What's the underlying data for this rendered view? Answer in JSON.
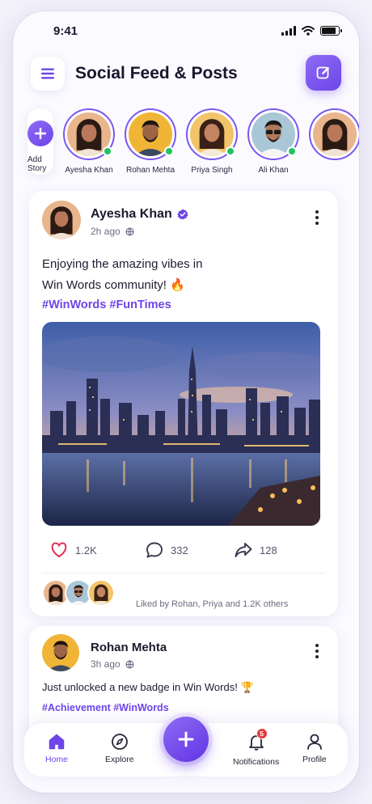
{
  "status_bar": {
    "time": "9:41"
  },
  "header": {
    "title": "Social Feed & Posts"
  },
  "stories": {
    "add_label": "Add Story",
    "items": [
      {
        "name": "Ayesha Khan",
        "online": true
      },
      {
        "name": "Rohan Mehta",
        "online": true
      },
      {
        "name": "Priya Singh",
        "online": true
      },
      {
        "name": "Ali Khan",
        "online": true
      }
    ]
  },
  "post": {
    "author": "Ayesha Khan",
    "verified": true,
    "time": "2h ago",
    "text_line1": "Enjoying the amazing vibes in",
    "text_line2": "Win Words community! 🔥",
    "tags": "#WinWords #FunTimes",
    "likes": "1.2K",
    "comments": "332",
    "shares": "128",
    "liked_by": "Liked by Rohan, Priya and 1.2K others"
  },
  "post2": {
    "author": "Rohan Mehta",
    "time": "3h ago",
    "text": "Just unlocked a new badge in Win Words! 🏆",
    "tags": "#Achievement #WinWords"
  },
  "bottom_nav": {
    "items": [
      {
        "label": "Home",
        "active": true
      },
      {
        "label": "Explore"
      },
      {
        "label": "Notifications",
        "badge": "5"
      },
      {
        "label": "Profile"
      }
    ]
  },
  "colors": {
    "accent": "#6d45e8",
    "online": "#22c35e",
    "heart": "#e2325a",
    "badge": "#e83a3a"
  }
}
